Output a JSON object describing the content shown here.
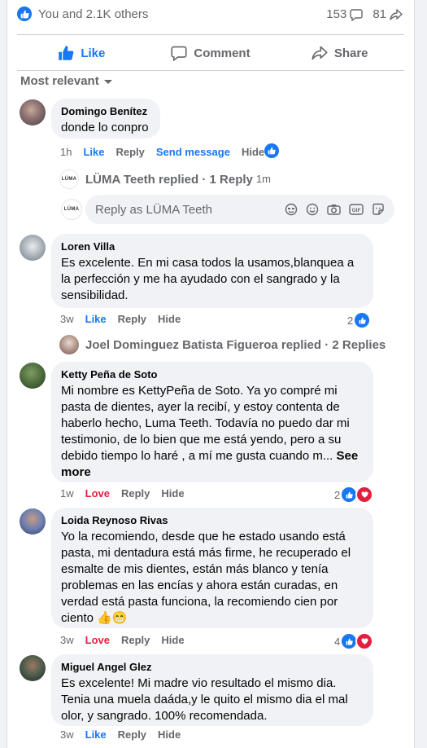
{
  "reactions": {
    "summary": "You and 2.1K others",
    "comments_count": "153",
    "shares_count": "81"
  },
  "actions": {
    "like": "Like",
    "comment": "Comment",
    "share": "Share"
  },
  "sort_label": "Most relevant",
  "page": {
    "name": "LÜMA Teeth",
    "logo_text": "LÜMA",
    "reply_placeholder": "Reply as LÜMA Teeth"
  },
  "comments": [
    {
      "author": "Domingo Benítez",
      "text": "donde lo conpro",
      "time": "1h",
      "like": "Like",
      "reply": "Reply",
      "send": "Send message",
      "hide": "Hide",
      "replied_line": "LÜMA Teeth replied · 1 Reply",
      "replied_time": "1m"
    },
    {
      "author": "Loren Villa",
      "text": "Es excelente. En mi casa todos la usamos,blanquea a la perfección y me ha ayudado con el sangrado y la sensibilidad.",
      "time": "3w",
      "like": "Like",
      "reply": "Reply",
      "hide": "Hide",
      "reaction_count": "2",
      "replied_line": "Joel Dominguez Batista Figueroa replied · 2 Replies"
    },
    {
      "author": "Ketty Peña de Soto",
      "text": "Mi nombre es KettyPeña de Soto. Ya yo compré mi pasta de dientes, ayer la recibí, y estoy contenta de haberlo hecho, Luma Teeth. Todavía no puedo dar mi testimonio, de lo bien que me está yendo, pero a su debido tiempo lo haré , a mí me gusta cuando m...",
      "see_more": "See more",
      "time": "1w",
      "like": "Love",
      "reply": "Reply",
      "hide": "Hide",
      "reaction_count": "2"
    },
    {
      "author": "Loida Reynoso Rivas",
      "text": "Yo la recomiendo, desde que he estado usando está pasta, mi dentadura está más firme, he recuperado el esmalte de mis dientes, están más blanco y tenía problemas en las encías y ahora están curadas, en verdad está pasta funciona, la recomiendo cien por ciento 👍😁",
      "time": "3w",
      "like": "Love",
      "reply": "Reply",
      "hide": "Hide",
      "reaction_count": "4"
    },
    {
      "author": "Miguel Angel Glez",
      "text": "Es excelente! Mi madre vio resultado el mismo dia. Tenia una muela daáda,y le quito el mismo dia el mal olor, y sangrado. 100% recomendada.",
      "time": "3w",
      "like": "Like",
      "reply": "Reply",
      "hide": "Hide"
    }
  ],
  "colors": {
    "blue": "#1877f2",
    "love": "#e41e3f",
    "meta": "#65676b",
    "bubble": "#f0f2f5"
  }
}
